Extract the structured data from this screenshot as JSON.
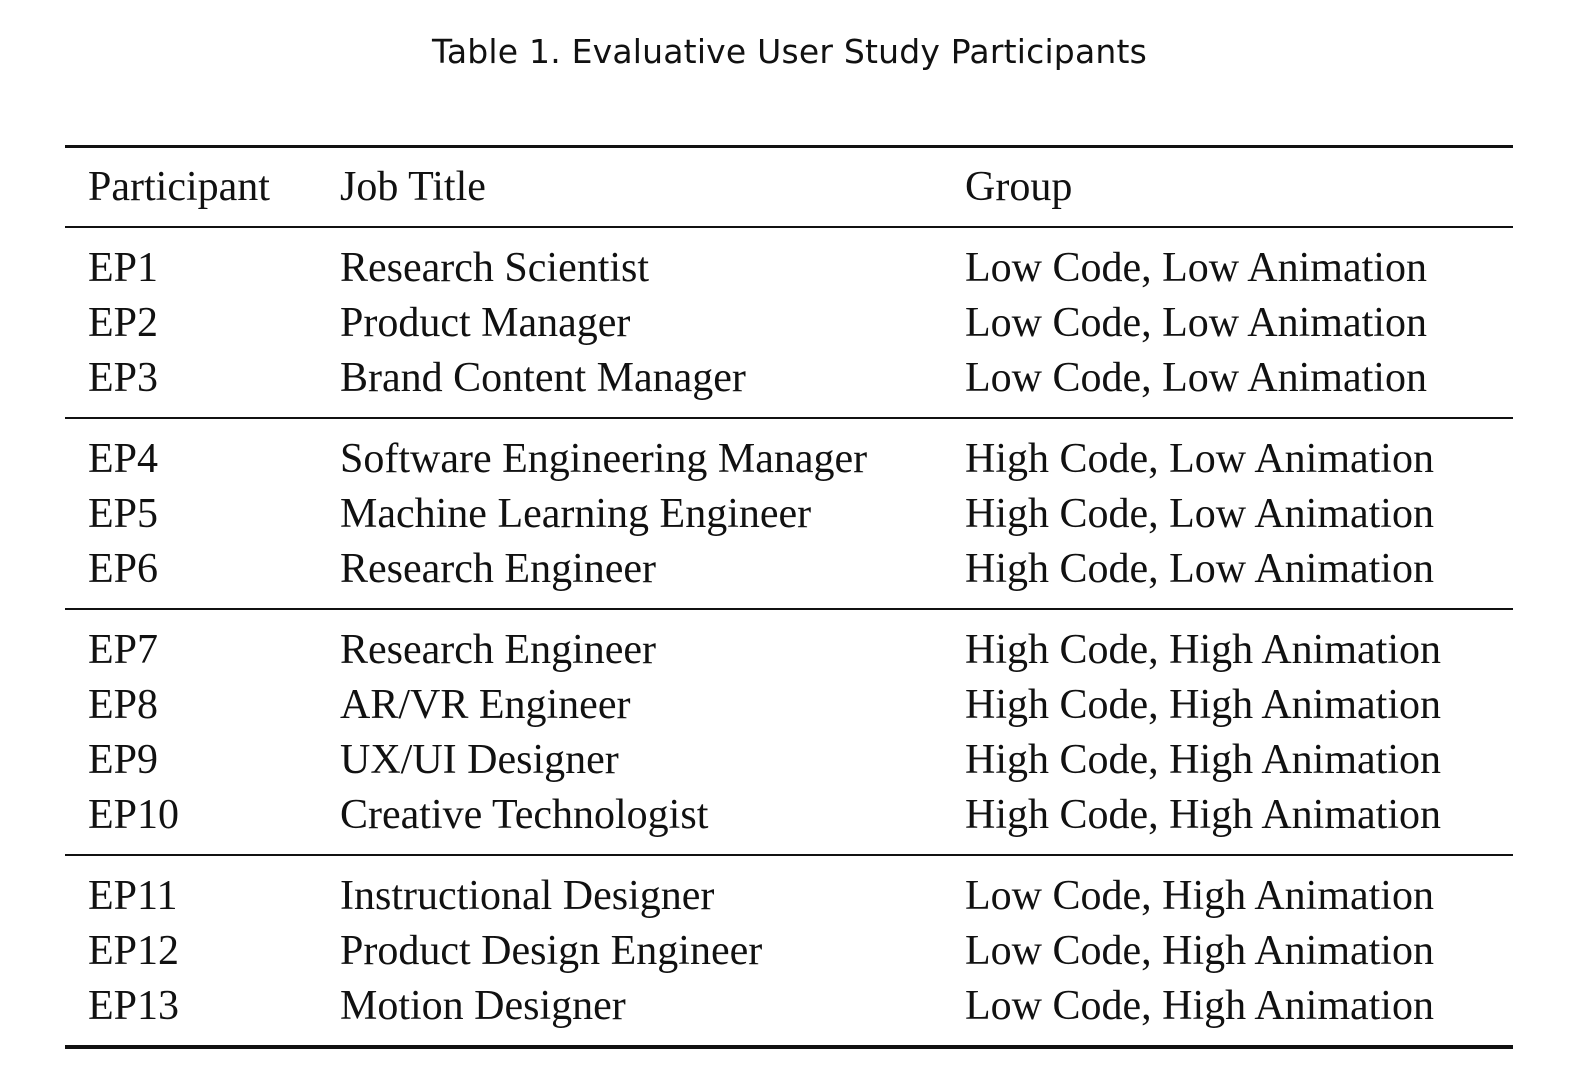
{
  "caption": "Table 1.  Evaluative User Study Participants",
  "columns": [
    "Participant",
    "Job Title",
    "Group"
  ],
  "groups": [
    {
      "rows": [
        {
          "participant": "EP1",
          "job_title": "Research Scientist",
          "group": "Low Code, Low Animation"
        },
        {
          "participant": "EP2",
          "job_title": "Product Manager",
          "group": "Low Code, Low Animation"
        },
        {
          "participant": "EP3",
          "job_title": "Brand Content Manager",
          "group": "Low Code, Low Animation"
        }
      ]
    },
    {
      "rows": [
        {
          "participant": "EP4",
          "job_title": "Software Engineering Manager",
          "group": "High Code, Low Animation"
        },
        {
          "participant": "EP5",
          "job_title": "Machine Learning Engineer",
          "group": "High Code, Low Animation"
        },
        {
          "participant": "EP6",
          "job_title": "Research Engineer",
          "group": "High Code, Low Animation"
        }
      ]
    },
    {
      "rows": [
        {
          "participant": "EP7",
          "job_title": "Research Engineer",
          "group": "High Code, High Animation"
        },
        {
          "participant": "EP8",
          "job_title": "AR/VR Engineer",
          "group": "High Code, High Animation"
        },
        {
          "participant": "EP9",
          "job_title": "UX/UI Designer",
          "group": "High Code, High Animation"
        },
        {
          "participant": "EP10",
          "job_title": "Creative Technologist",
          "group": "High Code, High Animation"
        }
      ]
    },
    {
      "rows": [
        {
          "participant": "EP11",
          "job_title": "Instructional Designer",
          "group": "Low Code, High Animation"
        },
        {
          "participant": "EP12",
          "job_title": "Product Design Engineer",
          "group": "Low Code, High Animation"
        },
        {
          "participant": "EP13",
          "job_title": "Motion Designer",
          "group": "Low Code, High Animation"
        }
      ]
    }
  ]
}
